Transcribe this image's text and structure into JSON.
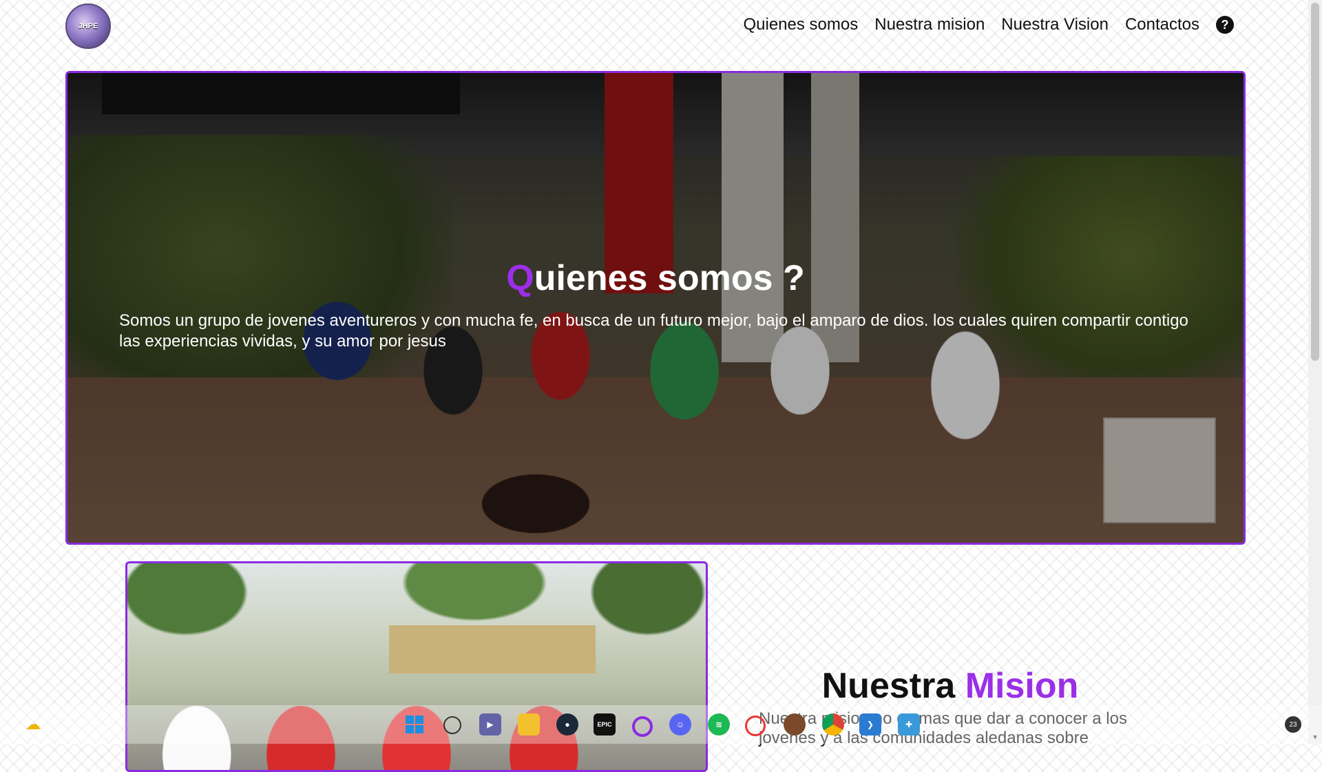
{
  "logo": {
    "text": "JHPE"
  },
  "nav": {
    "items": [
      {
        "label": "Quienes somos"
      },
      {
        "label": "Nuestra mision"
      },
      {
        "label": "Nuestra Vision"
      },
      {
        "label": "Contactos"
      }
    ],
    "help_glyph": "?"
  },
  "hero": {
    "title_first_letter": "Q",
    "title_rest": "uienes somos ?",
    "text": "Somos un grupo de jovenes aventureros y con mucha fe, en busca de un futuro mejor, bajo el amparo de dios. los cuales quiren compartir contigo las experiencias vividas, y su amor por jesus"
  },
  "mision": {
    "title_main": "Nuestra ",
    "title_accent": "Mision",
    "text": "Nuestra mision no es mas que dar a conocer a los jovenes y a las comunidades aledanas sobre"
  },
  "taskbar": {
    "icons": [
      "weather-icon",
      "windows-start-icon",
      "search-icon",
      "meet-icon",
      "file-explorer-icon",
      "steam-icon",
      "epic-games-icon",
      "ring-app-icon",
      "discord-icon",
      "spotify-icon",
      "opera-icon",
      "user-app-icon",
      "chrome-icon",
      "vscode-icon",
      "app-icon"
    ],
    "epic_label": "EPIC",
    "notification_count": "23"
  },
  "colors": {
    "accent": "#9b2fe8",
    "border": "#8a2be2"
  }
}
